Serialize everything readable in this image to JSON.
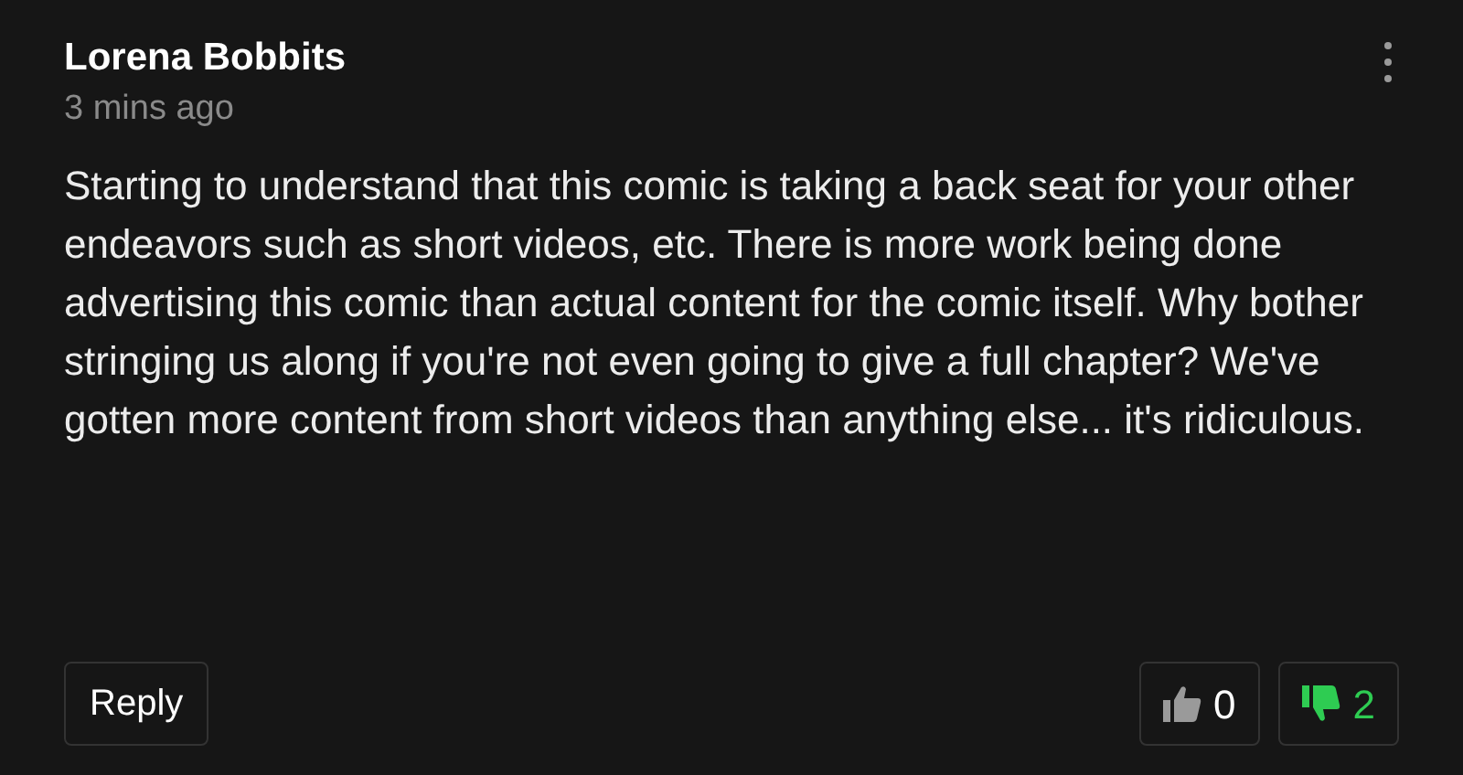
{
  "comment": {
    "author": "Lorena Bobbits",
    "time": "3 mins ago",
    "body": "Starting to understand that this comic is taking a back seat for your other endeavors such as short videos, etc. There is more work being done advertising this comic than actual content for the comic itself. Why bother stringing us along if you're not even going to give a full chapter? We've gotten more content from short videos than anything else... it's ridiculous."
  },
  "reply_button": "Reply",
  "votes": [
    {
      "kind": "like",
      "count": "0",
      "selected": false
    },
    {
      "kind": "dislike",
      "count": "2",
      "selected": true
    }
  ]
}
